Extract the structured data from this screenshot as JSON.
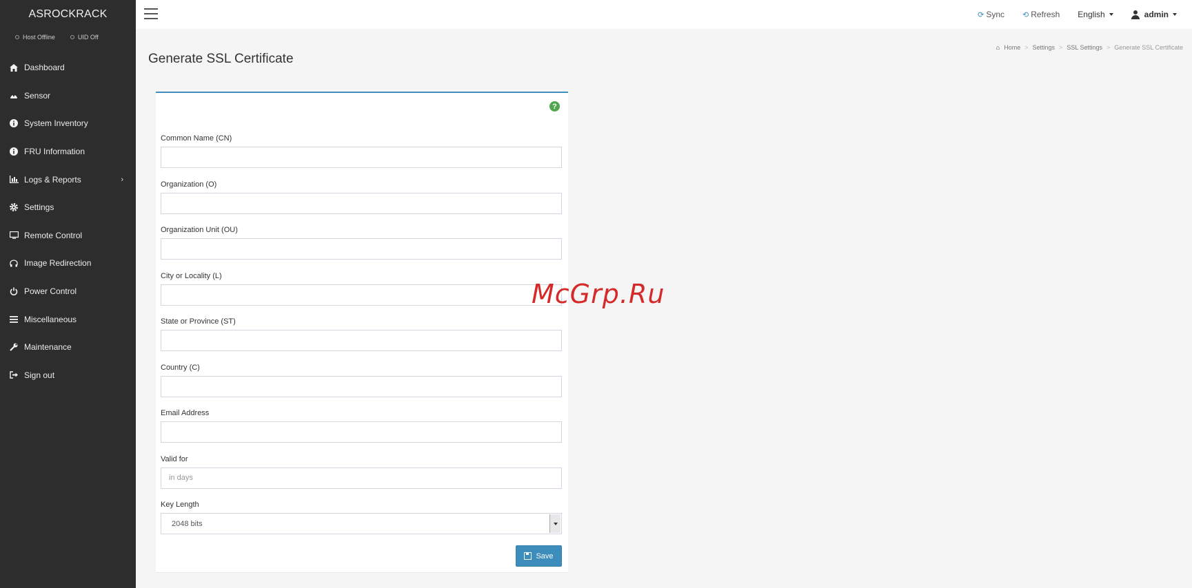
{
  "sidebar": {
    "brand": "ASROCKRACK",
    "status": [
      {
        "label": "Host Offline"
      },
      {
        "label": "UID Off"
      }
    ],
    "items": [
      {
        "label": "Dashboard",
        "icon": "home-icon"
      },
      {
        "label": "Sensor",
        "icon": "sensor-icon"
      },
      {
        "label": "System Inventory",
        "icon": "info-icon"
      },
      {
        "label": "FRU Information",
        "icon": "info-icon"
      },
      {
        "label": "Logs & Reports",
        "icon": "bar-chart-icon",
        "has_submenu": true
      },
      {
        "label": "Settings",
        "icon": "gear-icon"
      },
      {
        "label": "Remote Control",
        "icon": "monitor-icon"
      },
      {
        "label": "Image Redirection",
        "icon": "disc-icon"
      },
      {
        "label": "Power Control",
        "icon": "power-icon"
      },
      {
        "label": "Miscellaneous",
        "icon": "list-icon"
      },
      {
        "label": "Maintenance",
        "icon": "wrench-icon"
      },
      {
        "label": "Sign out",
        "icon": "sign-out-icon"
      }
    ]
  },
  "topbar": {
    "sync": "Sync",
    "refresh": "Refresh",
    "language": "English",
    "user": "admin"
  },
  "page": {
    "title": "Generate SSL Certificate",
    "breadcrumb": [
      "Home",
      "Settings",
      "SSL Settings",
      "Generate SSL Certificate"
    ]
  },
  "form": {
    "fields": [
      {
        "label": "Common Name (CN)",
        "value": "",
        "placeholder": ""
      },
      {
        "label": "Organization (O)",
        "value": "",
        "placeholder": ""
      },
      {
        "label": "Organization Unit (OU)",
        "value": "",
        "placeholder": ""
      },
      {
        "label": "City or Locality (L)",
        "value": "",
        "placeholder": ""
      },
      {
        "label": "State or Province (ST)",
        "value": "",
        "placeholder": ""
      },
      {
        "label": "Country (C)",
        "value": "",
        "placeholder": ""
      },
      {
        "label": "Email Address",
        "value": "",
        "placeholder": ""
      },
      {
        "label": "Valid for",
        "value": "",
        "placeholder": "in days"
      }
    ],
    "key_length": {
      "label": "Key Length",
      "selected": "2048 bits"
    },
    "save_label": "Save",
    "help": "?"
  },
  "watermark": "McGrp.Ru",
  "colors": {
    "sidebar_bg": "#2d2d2d",
    "accent": "#3c8dbc",
    "help_green": "#4fa64f",
    "watermark_red": "#d42a2a"
  }
}
